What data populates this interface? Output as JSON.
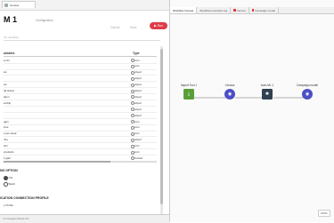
{
  "left_tab": {
    "label": "Census"
  },
  "header": {
    "title": "M 1",
    "subtitle": "Configuration",
    "cancel_label": "Cancel",
    "save_label": "Save",
    "run_label": "Run"
  },
  "search": {
    "placeholder": "rch variables"
  },
  "table": {
    "col_name": "ariables",
    "col_type": "Type",
    "rows": [
      {
        "name": "er ID",
        "type": "intxt"
      },
      {
        "name": "",
        "type": "intxt"
      },
      {
        "name": "ion",
        "type": "object"
      },
      {
        "name": "",
        "type": "object"
      },
      {
        "name": "ion",
        "type": "object"
      },
      {
        "name": "tal status",
        "type": "object"
      },
      {
        "name": "ation",
        "type": "object"
      },
      {
        "name": "ership",
        "type": "object"
      },
      {
        "name": "",
        "type": "object"
      },
      {
        "name": "",
        "type": "object"
      },
      {
        "name": "gain",
        "type": "intxt"
      },
      {
        "name": "loss",
        "type": "intxt"
      },
      {
        "name": "s per week",
        "type": "intxt"
      },
      {
        "name": "ntry",
        "type": "object"
      },
      {
        "name": "tion",
        "type": "intxt"
      },
      {
        "name": "products",
        "type": "intxt"
      },
      {
        "name": "it gain",
        "type": "Scaled"
      }
    ]
  },
  "sections": {
    "scoring": "NG OPTION",
    "scoring_opt1": "ON",
    "scoring_opt2": "Batch",
    "profile": "ICATION CONNECTION PROFILE",
    "profile_opt": "e Profile"
  },
  "status_text": "m-nomages-sheets.com",
  "right_tabs": [
    {
      "label": "Workflow Canvas",
      "active": true,
      "color": ""
    },
    {
      "label": "Workflow execution log",
      "active": false,
      "color": ""
    },
    {
      "label": "Census",
      "active": false,
      "color": "#e03a48"
    },
    {
      "label": "Campaign model",
      "active": false,
      "color": "#e03a48"
    }
  ],
  "nodes": [
    {
      "label": "Import Tool 1",
      "color": "#5a9e3a",
      "icon": "import-tool-icon"
    },
    {
      "label": "Census",
      "color": "#4b4fc4",
      "icon": "census-icon"
    },
    {
      "label": "Auto ML 1",
      "color": "#2f4050",
      "icon": "auto-ml-icon"
    },
    {
      "label": "Campaign model",
      "color": "#4b4fc4",
      "icon": "campaign-model-icon"
    }
  ],
  "zoom": "100%",
  "colors": {
    "accent": "#e03a48",
    "node_blue": "#4b4fc4"
  }
}
